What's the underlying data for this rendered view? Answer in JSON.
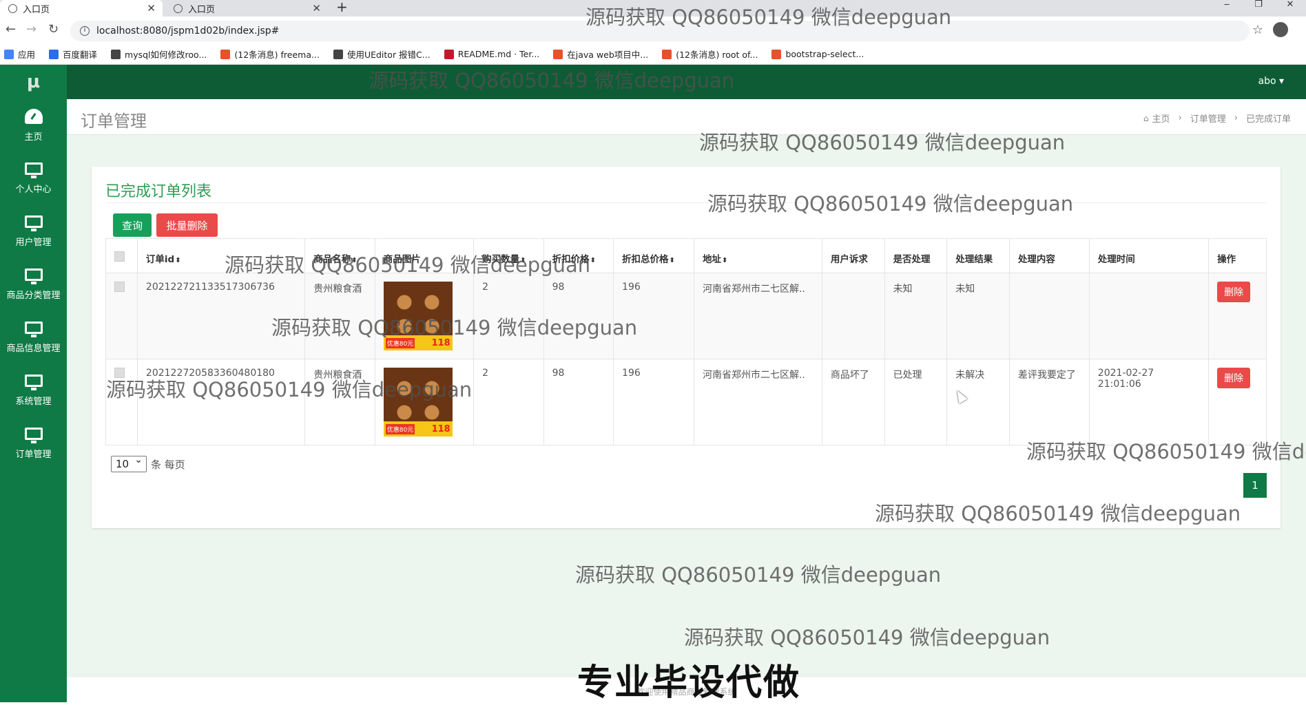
{
  "browser": {
    "tabs": [
      {
        "title": "入口页"
      },
      {
        "title": "入口页"
      }
    ],
    "url": "localhost:8080/jspm1d02b/index.jsp#",
    "bookmarks": [
      {
        "label": "应用",
        "color": "#4285f4"
      },
      {
        "label": "百度翻译",
        "color": "#2a6de8"
      },
      {
        "label": "mysql如何修改roo...",
        "color": "#444444"
      },
      {
        "label": "(12条消息) freema...",
        "color": "#e8512a"
      },
      {
        "label": "使用UEditor 报错C...",
        "color": "#444444"
      },
      {
        "label": "README.md · Ter...",
        "color": "#c7162b"
      },
      {
        "label": "在java web项目中...",
        "color": "#e8512a"
      },
      {
        "label": "(12条消息) root of...",
        "color": "#e8512a"
      },
      {
        "label": "bootstrap-select...",
        "color": "#e8512a"
      }
    ]
  },
  "app": {
    "logo": "μ",
    "user": "abo ▾",
    "sidebar": [
      {
        "label": "主页",
        "icon": "dashboard-icon"
      },
      {
        "label": "个人中心",
        "icon": "monitor-icon"
      },
      {
        "label": "用户管理",
        "icon": "monitor-icon"
      },
      {
        "label": "商品分类管理",
        "icon": "monitor-icon"
      },
      {
        "label": "商品信息管理",
        "icon": "monitor-icon"
      },
      {
        "label": "系统管理",
        "icon": "monitor-icon"
      },
      {
        "label": "订单管理",
        "icon": "monitor-icon"
      }
    ],
    "page_title": "订单管理",
    "breadcrumb": {
      "home": "主页",
      "section": "订单管理",
      "current": "已完成订单"
    },
    "card_title": "已完成订单列表",
    "buttons": {
      "query": "查询",
      "bulk_delete": "批量删除",
      "delete": "删除"
    },
    "columns": [
      "订单id",
      "商品名称",
      "商品图片",
      "购买数量",
      "折扣价格",
      "折扣总价格",
      "地址",
      "用户诉求",
      "是否处理",
      "处理结果",
      "处理内容",
      "处理时间",
      "操作"
    ],
    "rows": [
      {
        "id": "202122721133517306736",
        "name": "贵州粮食酒",
        "image_badge": "优惠80元",
        "image_price": "118",
        "quantity": "2",
        "price": "98",
        "total": "196",
        "address": "河南省郑州市二七区解..",
        "appeal": "",
        "handled": "未知",
        "result": "未知",
        "content": "",
        "time": ""
      },
      {
        "id": "2021227205833604801­80",
        "name": "贵州粮食酒",
        "image_badge": "优惠80元",
        "image_price": "118",
        "quantity": "2",
        "price": "98",
        "total": "196",
        "address": "河南省郑州市二七区解..",
        "appeal": "商品坏了",
        "handled": "已处理",
        "result": "未解决",
        "content": "差评我要定了",
        "time": "2021-02-27 21:01:06"
      }
    ],
    "page_size": "10",
    "page_size_suffix": "条 每页",
    "current_page": "1",
    "footer": "欢迎使用精品商城管理系统"
  },
  "overlay": {
    "watermark": "源码获取 QQ86050149 微信deepguan",
    "banner": "专业毕设代做"
  }
}
